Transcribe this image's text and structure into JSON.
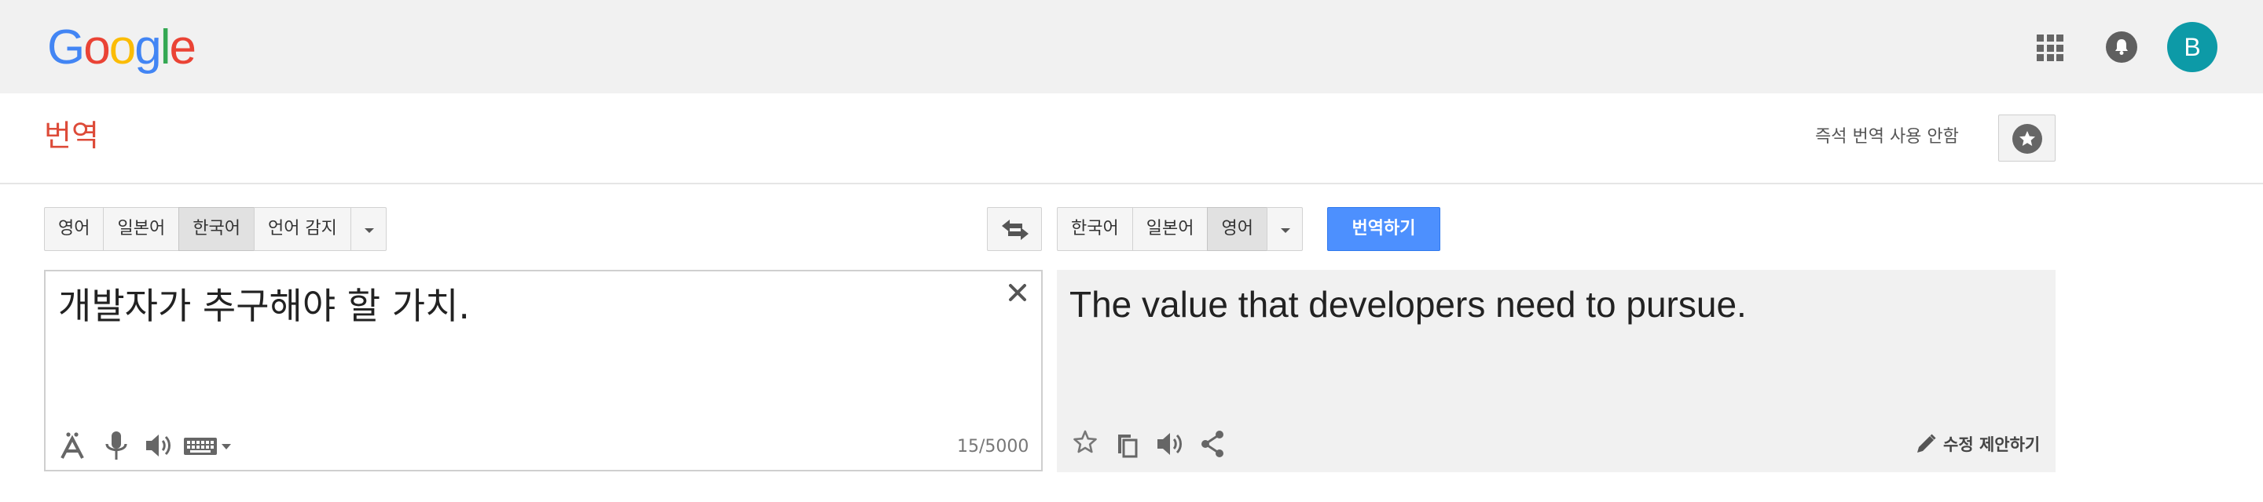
{
  "header": {
    "logo": [
      "G",
      "o",
      "o",
      "g",
      "l",
      "e"
    ],
    "logo_colors": [
      "#4285f4",
      "#ea4335",
      "#fbbc05",
      "#4285f4",
      "#34a853",
      "#ea4335"
    ],
    "avatar_initial": "B",
    "avatar_color": "#0d9aa7"
  },
  "page": {
    "title": "번역",
    "instant_toggle": "즉석 번역 사용 안함"
  },
  "source": {
    "languages": [
      "영어",
      "일본어",
      "한국어",
      "언어 감지"
    ],
    "selected_language": "한국어",
    "text": "개발자가 추구해야 할 가치.",
    "char_count": "15/5000"
  },
  "target": {
    "languages": [
      "한국어",
      "일본어",
      "영어"
    ],
    "selected_language": "영어",
    "translate_button": "번역하기",
    "text": "The value that developers need to pursue.",
    "suggest_edit": "수정 제안하기"
  },
  "icons": {
    "apps": "apps-grid-icon",
    "notifications": "bell-icon",
    "saved": "star-icon",
    "swap": "swap-languages-icon",
    "clear": "close-icon",
    "input_tools": [
      "font-icon",
      "microphone-icon",
      "speaker-icon",
      "keyboard-icon"
    ],
    "output_tools": [
      "star-outline-icon",
      "copy-icon",
      "speaker-icon",
      "share-icon"
    ],
    "edit": "pencil-icon"
  },
  "colors": {
    "accent_blue": "#4d90fe",
    "title_red": "#dd4b39"
  }
}
